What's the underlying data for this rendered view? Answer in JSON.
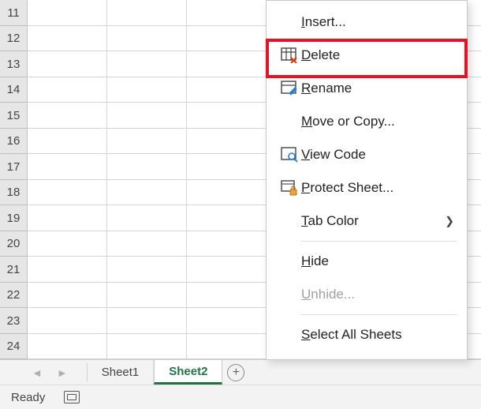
{
  "rows_start": 11,
  "rows_end": 24,
  "tabs": {
    "sheet1": "Sheet1",
    "sheet2": "Sheet2"
  },
  "status": {
    "ready": "Ready"
  },
  "menu": {
    "insert": "Insert...",
    "delete": "Delete",
    "rename": "Rename",
    "move_or_copy": "Move or Copy...",
    "view_code": "View Code",
    "protect_sheet": "Protect Sheet...",
    "tab_color": "Tab Color",
    "hide": "Hide",
    "unhide": "Unhide...",
    "select_all_sheets": "Select All Sheets"
  }
}
